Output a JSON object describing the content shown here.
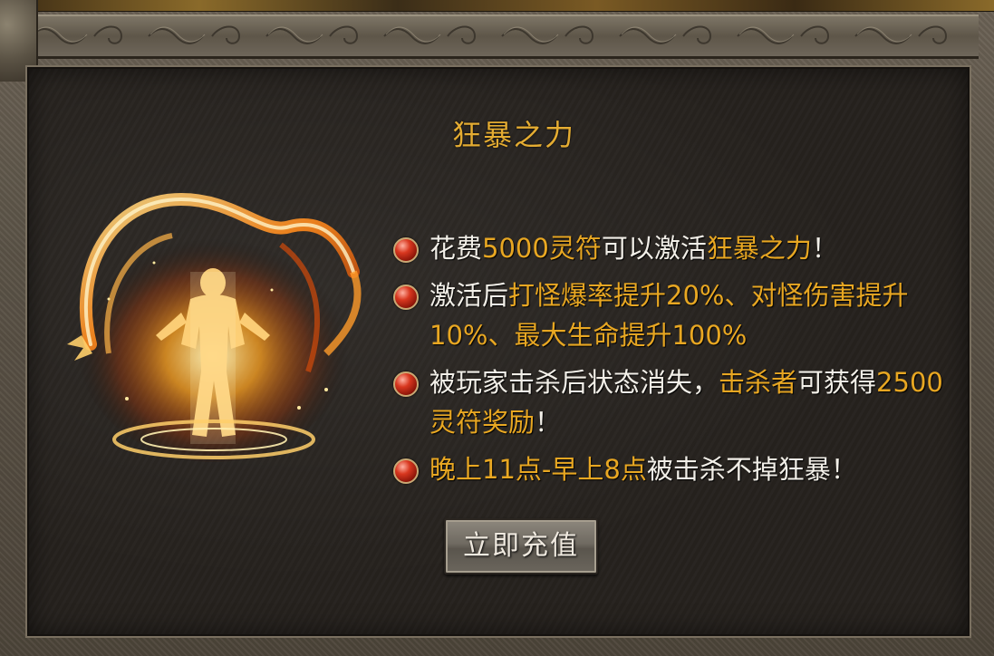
{
  "panel": {
    "title": "狂暴之力"
  },
  "features": [
    {
      "parts": [
        {
          "text": "花费",
          "hl": false
        },
        {
          "text": "5000灵符",
          "hl": true
        },
        {
          "text": "可以激活",
          "hl": false
        },
        {
          "text": "狂暴之力",
          "hl": true
        },
        {
          "text": "！",
          "hl": false
        }
      ]
    },
    {
      "parts": [
        {
          "text": "激活后",
          "hl": false
        },
        {
          "text": "打怪爆率提升20%、对怪伤害提升10%、最大生命提升100%",
          "hl": true
        }
      ]
    },
    {
      "parts": [
        {
          "text": "被玩家击杀后状态消失，",
          "hl": false
        },
        {
          "text": "击杀者",
          "hl": true
        },
        {
          "text": "可获得",
          "hl": false
        },
        {
          "text": "2500灵符奖励",
          "hl": true
        },
        {
          "text": "！",
          "hl": false
        }
      ]
    },
    {
      "parts": [
        {
          "text": "晚上11点-早上8点",
          "hl": true
        },
        {
          "text": "被击杀不掉狂暴！",
          "hl": false
        }
      ]
    }
  ],
  "button": {
    "label": "立即充值"
  },
  "colors": {
    "highlight": "#e8a722",
    "title": "#e4ac32",
    "text": "#f2efe8",
    "panel_bg": "#26221e"
  },
  "icons": {
    "bullet": "red-orb-icon",
    "artwork": "flaming-dragon-warrior-icon"
  }
}
